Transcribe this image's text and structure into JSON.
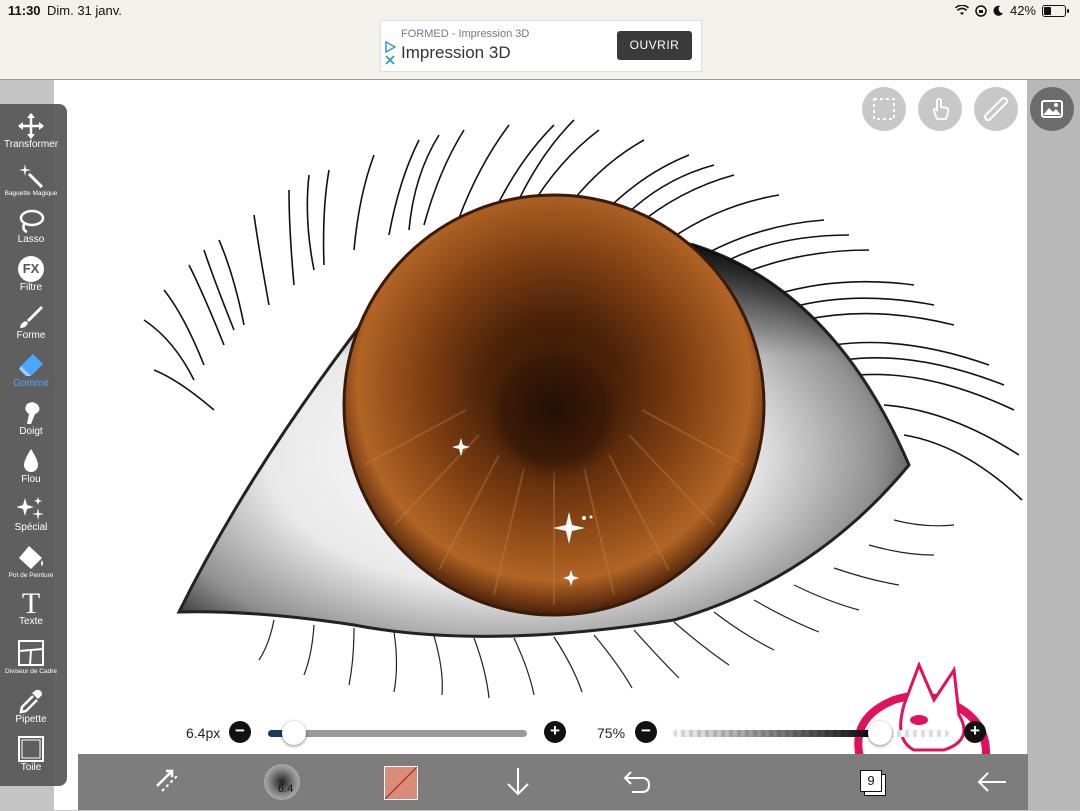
{
  "status": {
    "time": "11:30",
    "date": "Dim. 31 janv.",
    "battery": "42%"
  },
  "ad": {
    "sponsor": "FORMED - Impression 3D",
    "headline": "Impression 3D",
    "cta": "OUVRIR"
  },
  "toolbar": {
    "items": [
      {
        "label": "Transformer",
        "icon": "move-icon"
      },
      {
        "label": "Baguette Magique",
        "icon": "magic-wand-icon"
      },
      {
        "label": "Lasso",
        "icon": "lasso-icon"
      },
      {
        "label": "Filtre",
        "icon": "fx-icon",
        "glyph": "FX"
      },
      {
        "label": "Forme",
        "icon": "brush-icon"
      },
      {
        "label": "Gomme",
        "icon": "eraser-icon",
        "active": true
      },
      {
        "label": "Doigt",
        "icon": "smudge-icon"
      },
      {
        "label": "Flou",
        "icon": "blur-drop-icon"
      },
      {
        "label": "Spécial",
        "icon": "sparkle-icon"
      },
      {
        "label": "Pot de Peinture",
        "icon": "paint-bucket-icon"
      },
      {
        "label": "Texte",
        "icon": "text-icon",
        "glyph": "T"
      },
      {
        "label": "Diviseur de Cadre",
        "icon": "frame-divider-icon"
      },
      {
        "label": "Pipette",
        "icon": "eyedropper-icon"
      },
      {
        "label": "Toile",
        "icon": "canvas-icon"
      }
    ],
    "active_color": "#4aa8ff"
  },
  "top_buttons": [
    "selection-icon",
    "touch-icon",
    "ruler-icon",
    "image-icon"
  ],
  "sliders": {
    "size": {
      "label": "6.4px",
      "value_fraction": 0.1
    },
    "opacity": {
      "label": "75%",
      "value_fraction": 0.75
    }
  },
  "bottom": {
    "brush_size": "6.4",
    "layers_count": "9"
  },
  "colors": {
    "iris": "#8a4a1c",
    "selected_color": "#d98c7a"
  }
}
